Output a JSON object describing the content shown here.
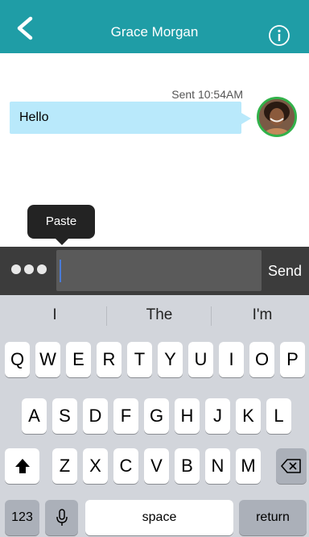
{
  "header": {
    "title": "Grace Morgan",
    "back_icon": "chevron-left-icon",
    "info_icon": "info-icon",
    "background": "#1f9da6"
  },
  "chat": {
    "messages": [
      {
        "sent_label": "Sent 10:54AM",
        "text": "Hello",
        "bubble_color": "#b9e9fb",
        "avatar_border": "#32b24a"
      }
    ]
  },
  "paste_menu": {
    "label": "Paste"
  },
  "input_bar": {
    "more_icon": "more-dots-icon",
    "value": "",
    "send_label": "Send"
  },
  "keyboard": {
    "suggestions": [
      "I",
      "The",
      "I'm"
    ],
    "row1": [
      "Q",
      "W",
      "E",
      "R",
      "T",
      "Y",
      "U",
      "I",
      "O",
      "P"
    ],
    "row2": [
      "A",
      "S",
      "D",
      "F",
      "G",
      "H",
      "J",
      "K",
      "L"
    ],
    "row3": [
      "Z",
      "X",
      "C",
      "V",
      "B",
      "N",
      "M"
    ],
    "numbers_label": "123",
    "space_label": "space",
    "return_label": "return",
    "shift_icon": "shift-icon",
    "delete_icon": "backspace-icon",
    "mic_icon": "microphone-icon"
  }
}
